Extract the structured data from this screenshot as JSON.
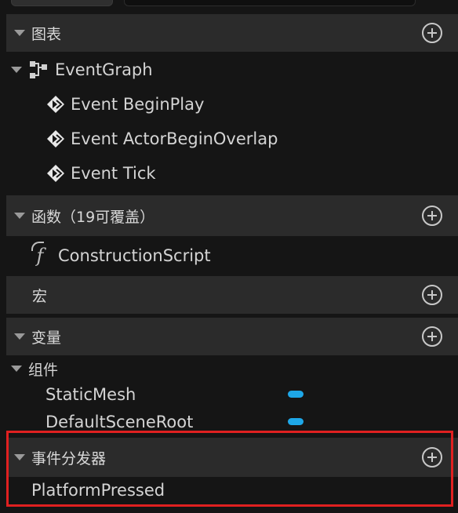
{
  "sections": {
    "graphs": {
      "title": "图表"
    },
    "functions": {
      "title": "函数（19可覆盖）"
    },
    "macros": {
      "title": "宏"
    },
    "variables": {
      "title": "变量"
    },
    "dispatchers": {
      "title": "事件分发器"
    }
  },
  "graph": {
    "event_graph": "EventGraph",
    "events": [
      "Event BeginPlay",
      "Event ActorBeginOverlap",
      "Event Tick"
    ]
  },
  "functions": {
    "construction_script": "ConstructionScript"
  },
  "variables": {
    "components_label": "组件",
    "components": [
      "StaticMesh",
      "DefaultSceneRoot"
    ],
    "component_color": "#1ea7e8"
  },
  "dispatchers": {
    "items": [
      "PlatformPressed"
    ]
  },
  "highlight_color": "#e02020"
}
